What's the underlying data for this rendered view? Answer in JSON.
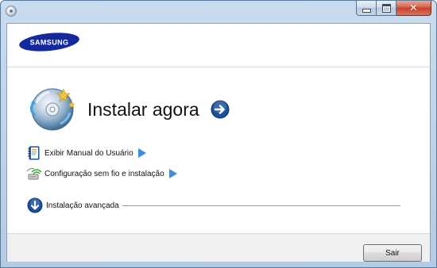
{
  "window": {
    "caption_buttons": {
      "minimize_icon": "minimize-icon",
      "maximize_icon": "maximize-icon",
      "close_glyph": "✕"
    }
  },
  "header": {
    "brand": "SAMSUNG",
    "brand_color": "#1428a0"
  },
  "main": {
    "install_now_label": "Instalar agora",
    "links": [
      {
        "label": "Exibir Manual do Usuário",
        "icon": "manual-icon"
      },
      {
        "label": "Configuração sem fio e instalação",
        "icon": "wireless-icon"
      }
    ],
    "advanced_label": "Instalação avançada"
  },
  "footer": {
    "exit_label": "Sair"
  },
  "colors": {
    "accent_blue": "#1a4f9c",
    "arrow_blue": "#3a8ee0"
  }
}
